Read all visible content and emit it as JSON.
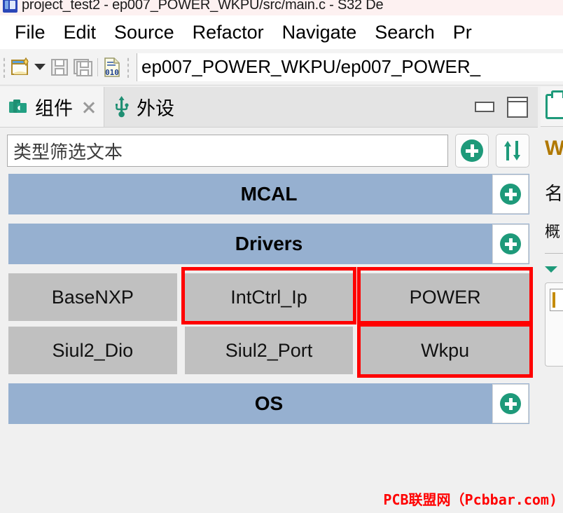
{
  "window": {
    "title": "project_test2 - ep007_POWER_WKPU/src/main.c - S32 De",
    "logo_icon": "s32-design-studio-logo"
  },
  "menubar": {
    "items": [
      {
        "label": "File"
      },
      {
        "label": "Edit"
      },
      {
        "label": "Source"
      },
      {
        "label": "Refactor"
      },
      {
        "label": "Navigate"
      },
      {
        "label": "Search"
      },
      {
        "label": "Pr"
      }
    ]
  },
  "toolbar": {
    "new_icon": "new-file-icon",
    "new_dropdown_icon": "chevron-down-icon",
    "save_icon": "save-icon",
    "save_all_icon": "save-all-icon",
    "hex_icon": "hex-editor-010-icon",
    "path_value": "ep007_POWER_WKPU/ep007_POWER_"
  },
  "components_view": {
    "tabs": [
      {
        "label": "组件",
        "icon": "components-icon",
        "active": true,
        "closable": true
      },
      {
        "label": "外设",
        "icon": "usb-peripherals-icon",
        "active": false,
        "closable": false
      }
    ],
    "close_icon": "close-icon",
    "minimize_icon": "minimize-icon",
    "maximize_icon": "maximize-icon",
    "filter": {
      "placeholder": "类型筛选文本",
      "value": ""
    },
    "add_button": {
      "label": "",
      "icon": "plus-circle-icon"
    },
    "sort_button": {
      "label": "↑↓",
      "icon": "sort-arrows-icon"
    },
    "groups": [
      {
        "name": "MCAL",
        "add_icon": "plus-circle-icon",
        "rows": []
      },
      {
        "name": "Drivers",
        "add_icon": "plus-circle-icon",
        "rows": [
          [
            {
              "label": "BaseNXP",
              "highlighted": false
            },
            {
              "label": "IntCtrl_Ip",
              "highlighted": true
            },
            {
              "label": "POWER",
              "highlighted": true
            }
          ],
          [
            {
              "label": "Siul2_Dio",
              "highlighted": false
            },
            {
              "label": "Siul2_Port",
              "highlighted": false
            },
            {
              "label": "Wkpu",
              "highlighted": true
            }
          ]
        ]
      },
      {
        "name": "OS",
        "add_icon": "plus-circle-icon",
        "rows": []
      }
    ]
  },
  "right_view": {
    "tab_icon": "clipboard-icon",
    "title": "W",
    "sub_label": "名",
    "sub_label2": "概",
    "arrow_icon": "collapse-arrow-icon",
    "field_value": ""
  },
  "watermark": {
    "text": "PCB联盟网（Pcbbar.com)"
  },
  "colors": {
    "group_header": "#96b0d0",
    "tile": "#c0c0c0",
    "accent_green": "#1e9a7a",
    "highlight_red": "#ff0000",
    "watermark_red": "#ff0000"
  }
}
